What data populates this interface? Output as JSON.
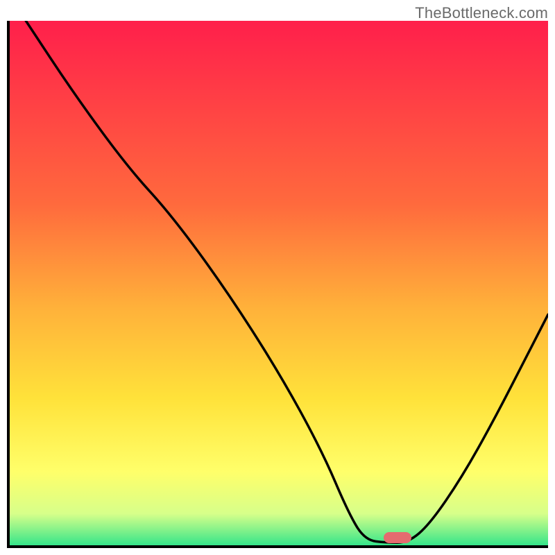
{
  "watermark": "TheBottleneck.com",
  "chart_data": {
    "type": "line",
    "title": "",
    "xlabel": "",
    "ylabel": "",
    "xlim": [
      0,
      100
    ],
    "ylim": [
      0,
      100
    ],
    "gradient_stops": [
      {
        "offset": 0,
        "color": "#ff1f4b"
      },
      {
        "offset": 35,
        "color": "#ff6a3d"
      },
      {
        "offset": 55,
        "color": "#ffb23a"
      },
      {
        "offset": 72,
        "color": "#ffe23a"
      },
      {
        "offset": 86,
        "color": "#ffff6a"
      },
      {
        "offset": 94,
        "color": "#d7ff8a"
      },
      {
        "offset": 100,
        "color": "#35e58a"
      }
    ],
    "series": [
      {
        "name": "curve",
        "points": [
          {
            "x": 3,
            "y": 100
          },
          {
            "x": 12,
            "y": 86
          },
          {
            "x": 22,
            "y": 72
          },
          {
            "x": 30,
            "y": 63
          },
          {
            "x": 40,
            "y": 49
          },
          {
            "x": 50,
            "y": 33
          },
          {
            "x": 58,
            "y": 18
          },
          {
            "x": 63,
            "y": 6
          },
          {
            "x": 66,
            "y": 1
          },
          {
            "x": 70,
            "y": 0.5
          },
          {
            "x": 74,
            "y": 0.5
          },
          {
            "x": 78,
            "y": 4
          },
          {
            "x": 84,
            "y": 13
          },
          {
            "x": 90,
            "y": 24
          },
          {
            "x": 96,
            "y": 36
          },
          {
            "x": 100,
            "y": 44
          }
        ]
      }
    ],
    "marker": {
      "x": 72,
      "y": 1.5,
      "color": "#e56b6f"
    }
  }
}
